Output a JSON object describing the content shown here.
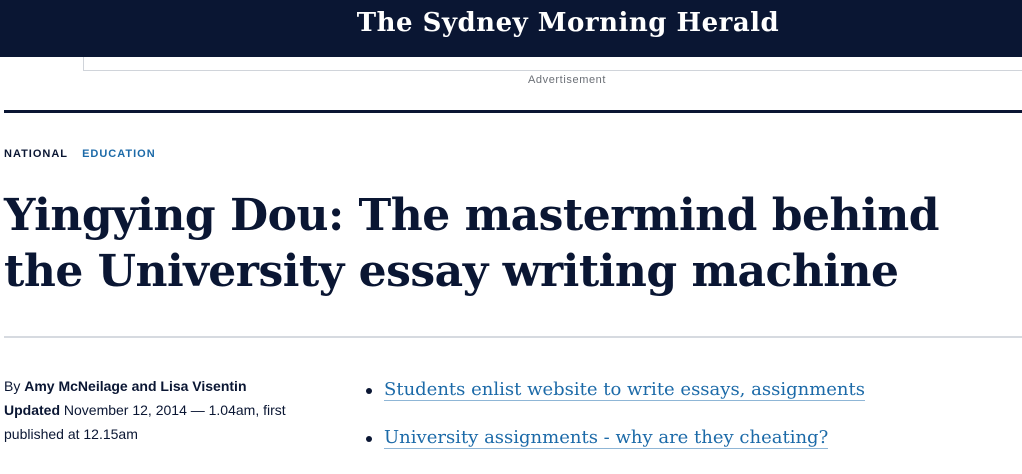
{
  "masthead": {
    "logo": "The Sydney Morning Herald"
  },
  "ad": {
    "label": "Advertisement"
  },
  "tags": {
    "primary": "NATIONAL",
    "secondary": "EDUCATION"
  },
  "article": {
    "headline": "Yingying Dou: The mastermind behind the University essay writing machine",
    "byline_prefix": "By",
    "authors": "Amy McNeilage and Lisa Visentin",
    "updated_label": "Updated",
    "updated_text": "November 12, 2014 — 1.04am, first published at 12.15am"
  },
  "related_links": [
    "Students enlist website to write essays, assignments",
    "University assignments - why are they cheating?"
  ],
  "colors": {
    "masthead_bg": "#0a1633",
    "link": "#1c6aa8",
    "text": "#0a1633"
  }
}
